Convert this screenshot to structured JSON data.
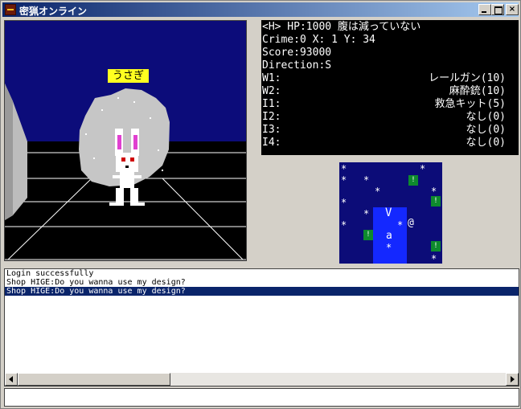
{
  "window": {
    "title": "密猟オンライン",
    "controls": {
      "minimize": "minimize",
      "maximize": "maximize",
      "close": "×"
    }
  },
  "view": {
    "creature_label": "うさぎ",
    "colors": {
      "sky": "#0c0c7a",
      "floor": "#000000",
      "grid": "#ffffff",
      "label_bg": "#ffff20"
    }
  },
  "status": {
    "line1": "<H> HP:1000 腹は減っていない",
    "line2": "Crime:0 X:  1 Y: 34",
    "line3": "Score:93000",
    "line4": "Direction:S",
    "slots": [
      {
        "key": "W1:",
        "value": "レールガン(10)"
      },
      {
        "key": "W2:",
        "value": "麻酔銃(10)"
      },
      {
        "key": "I1:",
        "value": "救急キット(5)"
      },
      {
        "key": "I2:",
        "value": "なし(0)"
      },
      {
        "key": "I3:",
        "value": "なし(0)"
      },
      {
        "key": "I4:",
        "value": "なし(0)"
      }
    ]
  },
  "minimap": {
    "player": "V",
    "creature": "a",
    "other": "@",
    "star": "*",
    "box": "!"
  },
  "log": {
    "lines": [
      "Login successfully",
      "Shop HIGE:Do you wanna use my design?",
      "Shop HIGE:Do you wanna use my design?"
    ]
  },
  "input": {
    "value": ""
  }
}
